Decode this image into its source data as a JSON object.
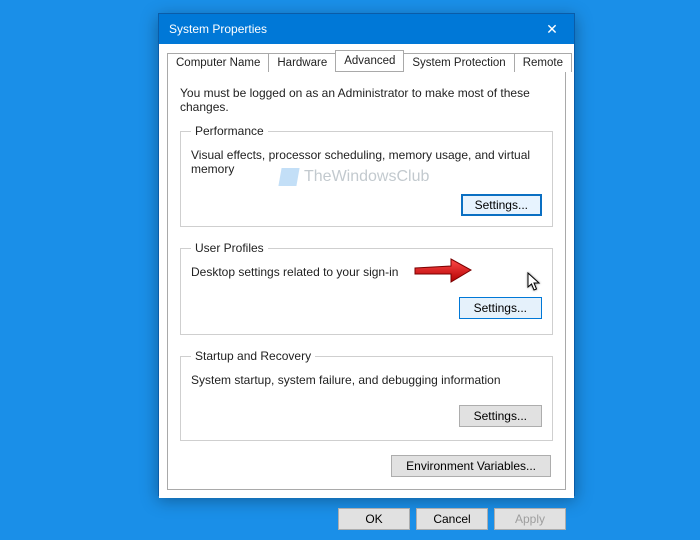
{
  "window": {
    "title": "System Properties"
  },
  "tabs": {
    "computerName": "Computer Name",
    "hardware": "Hardware",
    "advanced": "Advanced",
    "systemProtection": "System Protection",
    "remote": "Remote"
  },
  "intro": "You must be logged on as an Administrator to make most of these changes.",
  "groups": {
    "performance": {
      "legend": "Performance",
      "desc": "Visual effects, processor scheduling, memory usage, and virtual memory",
      "btn": "Settings..."
    },
    "userProfiles": {
      "legend": "User Profiles",
      "desc": "Desktop settings related to your sign-in",
      "btn": "Settings..."
    },
    "startup": {
      "legend": "Startup and Recovery",
      "desc": "System startup, system failure, and debugging information",
      "btn": "Settings..."
    }
  },
  "envBtn": "Environment Variables...",
  "footer": {
    "ok": "OK",
    "cancel": "Cancel",
    "apply": "Apply"
  },
  "watermark": "TheWindowsClub"
}
